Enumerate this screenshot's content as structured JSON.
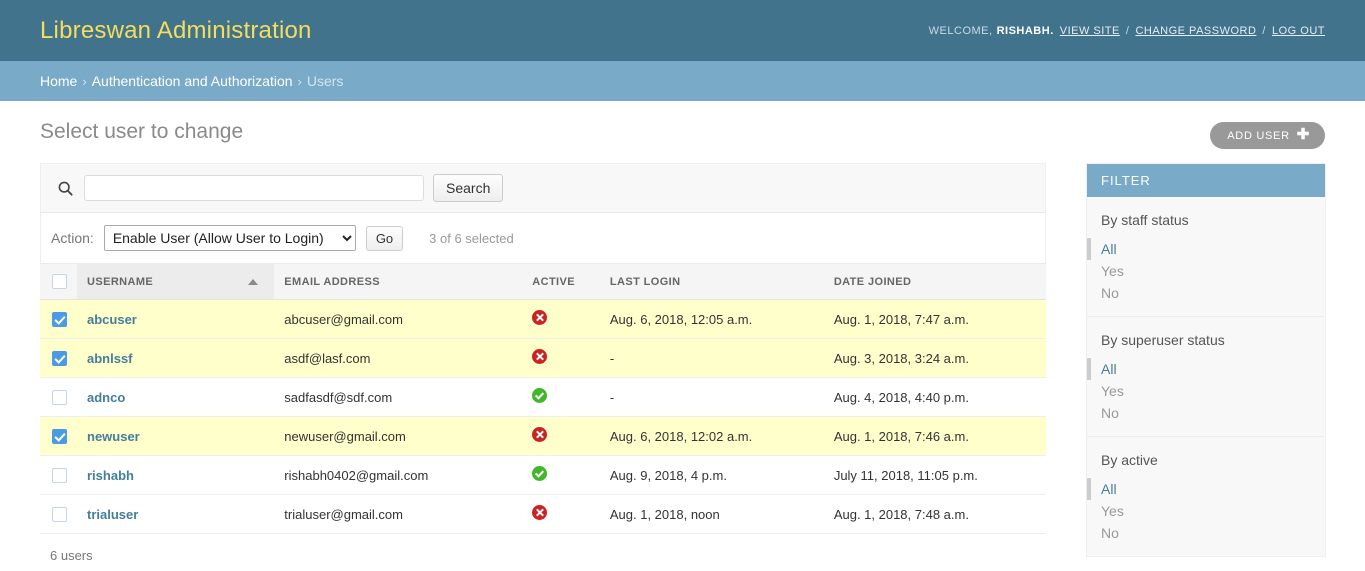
{
  "header": {
    "site_title": "Libreswan Administration",
    "welcome_text": "WELCOME,",
    "username": "RISHABH.",
    "view_site": "VIEW SITE",
    "change_password": "CHANGE PASSWORD",
    "log_out": "LOG OUT",
    "sep": "/"
  },
  "breadcrumbs": {
    "home": "Home",
    "sep": "›",
    "app": "Authentication and Authorization",
    "current": "Users"
  },
  "content": {
    "page_title": "Select user to change",
    "add_button": "ADD USER",
    "add_icon": "plus-icon"
  },
  "search": {
    "icon": "search-icon",
    "value": "",
    "placeholder": "",
    "submit_label": "Search"
  },
  "actions": {
    "label": "Action:",
    "selected": "Enable User (Allow User to Login)",
    "options": [
      "Enable User (Allow User to Login)"
    ],
    "go_label": "Go",
    "counter": "3 of 6 selected"
  },
  "table": {
    "select_all_checked": false,
    "columns": [
      {
        "key": "username",
        "label": "USERNAME",
        "sorted": "asc",
        "sort_icon": "sort-ascending-icon"
      },
      {
        "key": "email",
        "label": "EMAIL ADDRESS",
        "sorted": ""
      },
      {
        "key": "active",
        "label": "ACTIVE",
        "sorted": ""
      },
      {
        "key": "last_login",
        "label": "LAST LOGIN",
        "sorted": ""
      },
      {
        "key": "date_joined",
        "label": "DATE JOINED",
        "sorted": ""
      }
    ],
    "rows": [
      {
        "selected": true,
        "username": "abcuser",
        "email": "abcuser@gmail.com",
        "active": false,
        "last_login": "Aug. 6, 2018, 12:05 a.m.",
        "date_joined": "Aug. 1, 2018, 7:47 a.m."
      },
      {
        "selected": true,
        "username": "abnlssf",
        "email": "asdf@lasf.com",
        "active": false,
        "last_login": "-",
        "date_joined": "Aug. 3, 2018, 3:24 a.m."
      },
      {
        "selected": false,
        "username": "adnco",
        "email": "sadfasdf@sdf.com",
        "active": true,
        "last_login": "-",
        "date_joined": "Aug. 4, 2018, 4:40 p.m."
      },
      {
        "selected": true,
        "username": "newuser",
        "email": "newuser@gmail.com",
        "active": false,
        "last_login": "Aug. 6, 2018, 12:02 a.m.",
        "date_joined": "Aug. 1, 2018, 7:46 a.m."
      },
      {
        "selected": false,
        "username": "rishabh",
        "email": "rishabh0402@gmail.com",
        "active": true,
        "last_login": "Aug. 9, 2018, 4 p.m.",
        "date_joined": "July 11, 2018, 11:05 p.m."
      },
      {
        "selected": false,
        "username": "trialuser",
        "email": "trialuser@gmail.com",
        "active": false,
        "last_login": "Aug. 1, 2018, noon",
        "date_joined": "Aug. 1, 2018, 7:48 a.m."
      }
    ]
  },
  "paginator": {
    "count_label": "6 users"
  },
  "filter": {
    "header": "FILTER",
    "groups": [
      {
        "title": "By staff status",
        "options": [
          {
            "label": "All",
            "selected": true
          },
          {
            "label": "Yes",
            "selected": false
          },
          {
            "label": "No",
            "selected": false
          }
        ]
      },
      {
        "title": "By superuser status",
        "options": [
          {
            "label": "All",
            "selected": true
          },
          {
            "label": "Yes",
            "selected": false
          },
          {
            "label": "No",
            "selected": false
          }
        ]
      },
      {
        "title": "By active",
        "options": [
          {
            "label": "All",
            "selected": true
          },
          {
            "label": "Yes",
            "selected": false
          },
          {
            "label": "No",
            "selected": false
          }
        ]
      }
    ]
  },
  "colors": {
    "header_bg": "#41738d",
    "breadcrumb_bg": "#79aac8",
    "brand_text": "#f5dd5d",
    "link": "#447e9b",
    "selected_row": "#ffffcc",
    "checkbox_on": "#4b9ae5",
    "status_yes": "#42b72a",
    "status_no": "#cc2222",
    "add_button_bg": "#999999"
  }
}
